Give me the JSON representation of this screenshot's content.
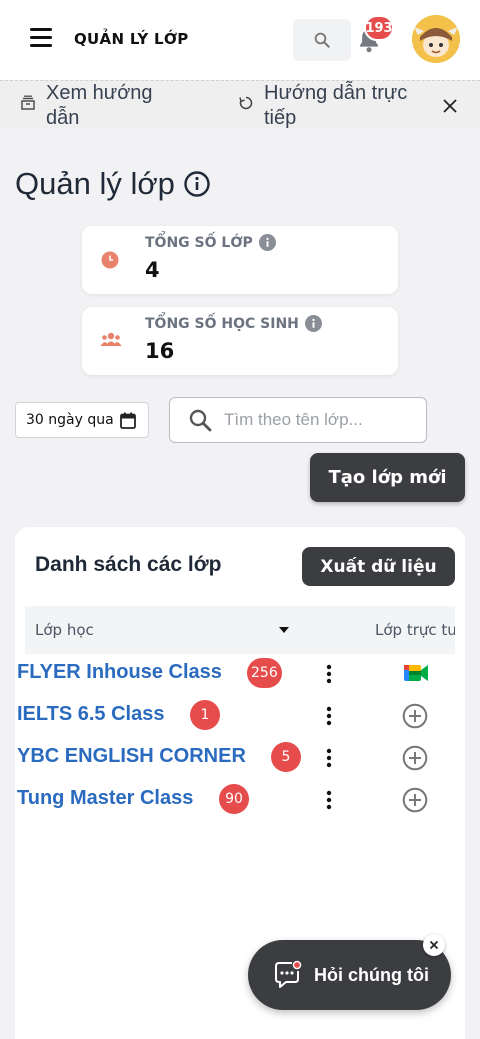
{
  "header": {
    "title": "QUẢN LÝ LỚP",
    "notification_count": "193"
  },
  "guide": {
    "view_guide": "Xem hướng dẫn",
    "live_guide": "Hướng dẫn trực tiếp"
  },
  "page": {
    "title": "Quản lý lớp"
  },
  "stats": [
    {
      "label": "TỔNG SỐ LỚP",
      "value": "4",
      "icon": "clock-icon",
      "color": "#e8826a"
    },
    {
      "label": "TỔNG SỐ HỌC SINH",
      "value": "16",
      "icon": "users-icon",
      "color": "#e8826a"
    }
  ],
  "filters": {
    "date_range": "30 ngày qua",
    "search_placeholder": "Tìm theo tên lớp..."
  },
  "actions": {
    "create_class": "Tạo lớp mới"
  },
  "class_list": {
    "title": "Danh sách các lớp",
    "export_label": "Xuất dữ liệu",
    "columns": [
      "Lớp học",
      "Lớp trực tu"
    ],
    "rows": [
      {
        "name": "FLYER Inhouse Class",
        "count": "256",
        "live": "google-meet-icon"
      },
      {
        "name": "IELTS 6.5 Class",
        "count": "1",
        "live": "add-circle-icon"
      },
      {
        "name": "YBC ENGLISH CORNER",
        "count": "5",
        "live": "add-circle-icon"
      },
      {
        "name": "Tung Master Class",
        "count": "90",
        "live": "add-circle-icon"
      }
    ]
  },
  "chat": {
    "label": "Hỏi chúng tôi"
  },
  "colors": {
    "accent_dark": "#3c3d41",
    "badge_red": "#e74c4c",
    "link_blue": "#2a6bbf"
  }
}
